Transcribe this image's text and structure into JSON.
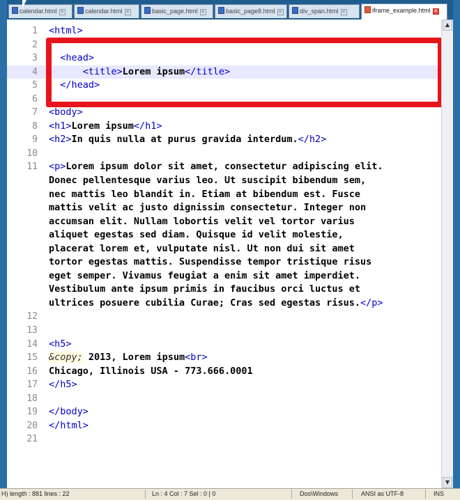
{
  "tabs": [
    {
      "label": "calendar.html",
      "active": false
    },
    {
      "label": "calendar.html",
      "active": false
    },
    {
      "label": "basic_page.html",
      "active": false
    },
    {
      "label": "basic_page8.html",
      "active": false
    },
    {
      "label": "div_span.html",
      "active": false
    },
    {
      "label": "iframe_example.html",
      "active": true
    }
  ],
  "editor": {
    "current_line": 4,
    "lines": [
      {
        "n": "1",
        "parts": [
          [
            "tag",
            "<html>"
          ]
        ]
      },
      {
        "n": "2",
        "parts": []
      },
      {
        "n": "3",
        "parts": [
          [
            "plain",
            "  "
          ],
          [
            "tag",
            "<head>"
          ]
        ]
      },
      {
        "n": "4",
        "parts": [
          [
            "plain",
            "      "
          ],
          [
            "tag",
            "<title>"
          ],
          [
            "bold",
            "Lorem ipsum"
          ],
          [
            "tag",
            "</title>"
          ]
        ]
      },
      {
        "n": "5",
        "parts": [
          [
            "plain",
            "  "
          ],
          [
            "tag",
            "</head>"
          ]
        ]
      },
      {
        "n": "6",
        "parts": []
      },
      {
        "n": "7",
        "parts": [
          [
            "tag",
            "<body>"
          ]
        ]
      },
      {
        "n": "8",
        "parts": [
          [
            "tag",
            "<h1>"
          ],
          [
            "bold",
            "Lorem ipsum"
          ],
          [
            "tag",
            "</h1>"
          ]
        ]
      },
      {
        "n": "9",
        "parts": [
          [
            "tag",
            "<h2>"
          ],
          [
            "bold",
            "In quis nulla at purus gravida interdum."
          ],
          [
            "tag",
            "</h2>"
          ]
        ]
      },
      {
        "n": "10",
        "parts": []
      },
      {
        "n": "11",
        "parts": [
          [
            "tag",
            "<p>"
          ],
          [
            "bold",
            "Lorem ipsum dolor sit amet, consectetur adipiscing elit."
          ]
        ]
      },
      {
        "n": "",
        "parts": [
          [
            "bold",
            "Donec pellentesque varius leo. Ut suscipit bibendum sem,"
          ]
        ]
      },
      {
        "n": "",
        "parts": [
          [
            "bold",
            "nec mattis leo blandit in. Etiam at bibendum est. Fusce"
          ]
        ]
      },
      {
        "n": "",
        "parts": [
          [
            "bold",
            "mattis velit ac justo dignissim consectetur. Integer non"
          ]
        ]
      },
      {
        "n": "",
        "parts": [
          [
            "bold",
            "accumsan elit. Nullam lobortis velit vel tortor varius"
          ]
        ]
      },
      {
        "n": "",
        "parts": [
          [
            "bold",
            "aliquet egestas sed diam. Quisque id velit molestie,"
          ]
        ]
      },
      {
        "n": "",
        "parts": [
          [
            "bold",
            "placerat lorem et, vulputate nisl. Ut non dui sit amet"
          ]
        ]
      },
      {
        "n": "",
        "parts": [
          [
            "bold",
            "tortor egestas mattis. Suspendisse tempor tristique risus"
          ]
        ]
      },
      {
        "n": "",
        "parts": [
          [
            "bold",
            "eget semper. Vivamus feugiat a enim sit amet imperdiet."
          ]
        ]
      },
      {
        "n": "",
        "parts": [
          [
            "bold",
            "Vestibulum ante ipsum primis in faucibus orci luctus et"
          ]
        ]
      },
      {
        "n": "",
        "parts": [
          [
            "bold",
            "ultrices posuere cubilia Curae; Cras sed egestas risus."
          ],
          [
            "tag",
            "</p>"
          ]
        ]
      },
      {
        "n": "12",
        "parts": []
      },
      {
        "n": "13",
        "parts": []
      },
      {
        "n": "14",
        "parts": [
          [
            "tag",
            "<h5>"
          ]
        ]
      },
      {
        "n": "15",
        "parts": [
          [
            "ent",
            "&copy;"
          ],
          [
            "bold",
            " 2013, Lorem ipsum"
          ],
          [
            "tag",
            "<br>"
          ]
        ]
      },
      {
        "n": "16",
        "parts": [
          [
            "bold",
            "Chicago, Illinois USA - 773.666.0001"
          ]
        ]
      },
      {
        "n": "17",
        "parts": [
          [
            "tag",
            "</h5>"
          ]
        ]
      },
      {
        "n": "18",
        "parts": []
      },
      {
        "n": "19",
        "parts": [
          [
            "tag",
            "</body>"
          ]
        ]
      },
      {
        "n": "20",
        "parts": [
          [
            "tag",
            "</html>"
          ]
        ]
      },
      {
        "n": "21",
        "parts": []
      }
    ]
  },
  "highlight_color": "#e8141c",
  "statusbar": {
    "length": "H) length : 881   lines : 22",
    "position": "Ln : 4   Col : 7   Sel : 0 | 0",
    "eol": "Dos\\Windows",
    "encoding": "ANSI as UTF-8",
    "mode": "INS"
  }
}
